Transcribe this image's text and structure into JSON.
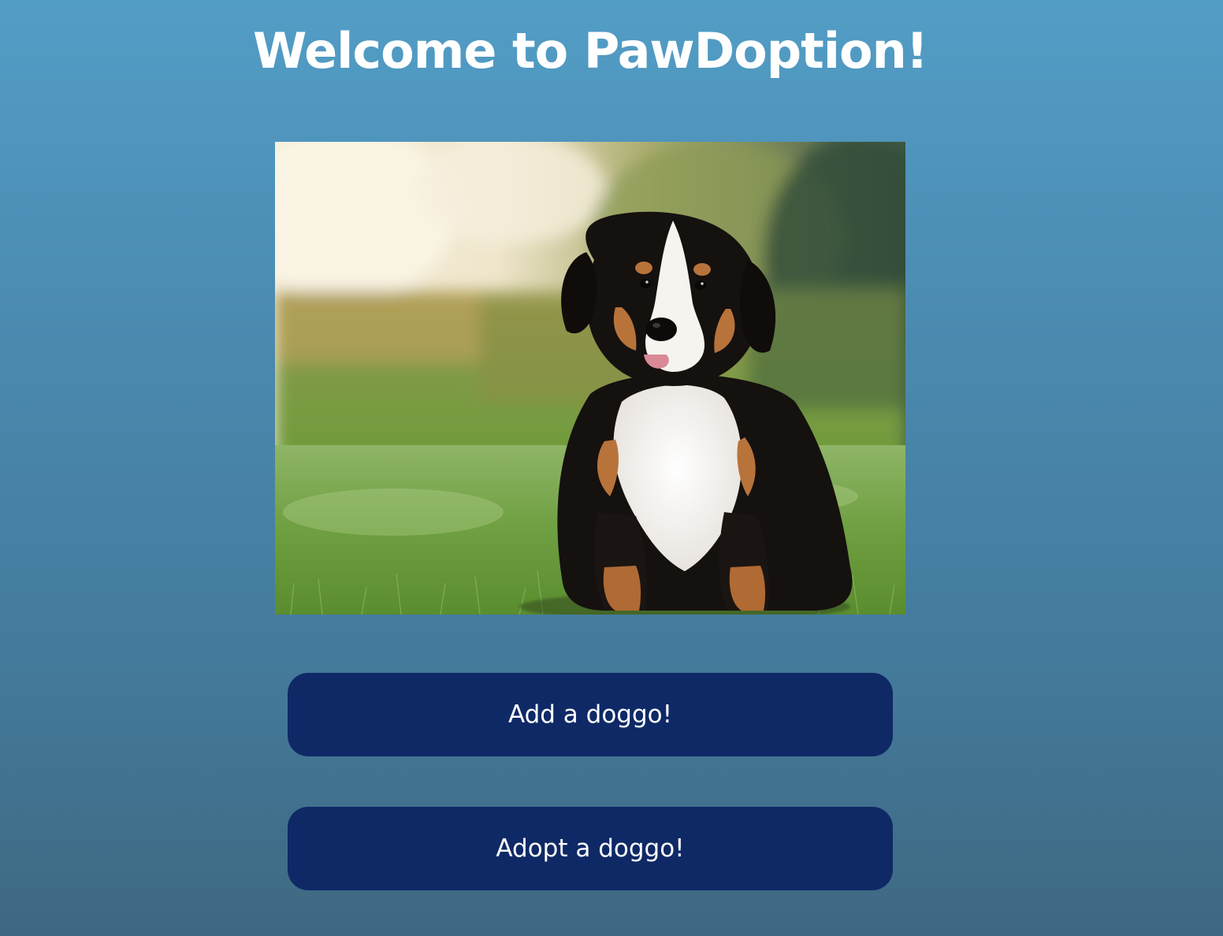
{
  "page": {
    "title": "Welcome to PawDoption!",
    "background_gradient": [
      "#529dc6",
      "#3e6881"
    ]
  },
  "hero": {
    "alt": "Bernese mountain dog puppy sitting on grass",
    "subject": "bernese-mountain-puppy"
  },
  "actions": {
    "add_label": "Add a doggo!",
    "adopt_label": "Adopt a doggo!",
    "button_color": "#0f2966"
  }
}
